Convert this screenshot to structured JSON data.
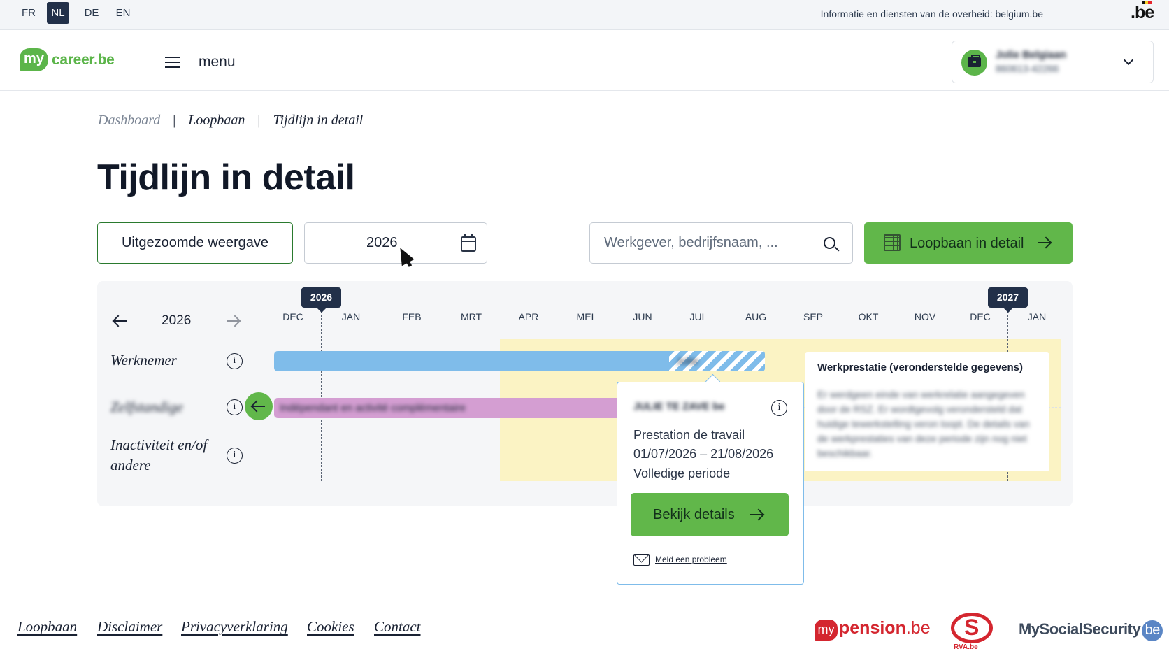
{
  "topbar": {
    "languages": [
      {
        "code": "FR",
        "active": false
      },
      {
        "code": "NL",
        "active": true
      },
      {
        "code": "DE",
        "active": false
      },
      {
        "code": "EN",
        "active": false
      }
    ],
    "gov_text": "Informatie en diensten van de overheid: belgium.be",
    "gov_logo": ".be"
  },
  "header": {
    "logo_my": "my",
    "logo_word": "career.be",
    "menu_label": "menu",
    "user_name": "Jolie Belgiaan",
    "user_id": "860613-42266"
  },
  "breadcrumb": [
    "Dashboard",
    "Loopbaan",
    "Tijdlijn in detail"
  ],
  "page_title": "Tijdlijn in detail",
  "controls": {
    "zoom_button": "Uitgezoomde weergave",
    "year_value": "2026",
    "search_placeholder": "Werkgever, bedrijfsnaam, ...",
    "career_button": "Loopbaan in detail"
  },
  "timeline": {
    "year": "2026",
    "months": [
      "DEC",
      "JAN",
      "FEB",
      "MRT",
      "APR",
      "MEI",
      "JUN",
      "JUL",
      "AUG",
      "SEP",
      "OKT",
      "NOV",
      "DEC",
      "JAN"
    ],
    "year_badges": [
      "2026",
      "2027"
    ],
    "rows": [
      {
        "label": "Werknemer"
      },
      {
        "label": "Zelfstandige"
      },
      {
        "label": "Inactiviteit en/of andere"
      }
    ],
    "hatch_label": "Jullie",
    "self_bar_label": "Indépendant en activité complémentaire",
    "info_glyph": "i"
  },
  "note": {
    "title": "Werkprestatie (veronderstelde gegevens)",
    "body": "Er werdgeen einde van werkrelatie aangegeven door de RSZ. Er wordtgevolg verondersteld dat huidige tewerkstelling veron loopt. De details van de werkprestaties van deze periode zijn nog niet beschikbaar."
  },
  "popover": {
    "employer": "JULIE TE ZAVE be",
    "line1": "Prestation de travail",
    "line2": "01/07/2026 – 21/08/2026",
    "line3": "Volledige periode",
    "details_button": "Bekijk details",
    "report_link": "Meld een probleem"
  },
  "footer": {
    "links": [
      "Loopbaan",
      "Disclaimer",
      "Privacyverklaring",
      "Cookies",
      "Contact"
    ],
    "mypension_my": "my",
    "mypension_word": "pension",
    "mypension_tld": ".be",
    "rva_s": "S",
    "rva_label": "RVA.be",
    "mss_word": "MySocialSecurity",
    "mss_tld": "be"
  },
  "colors": {
    "brand_green": "#61b74a",
    "navy": "#223049",
    "employee_bar": "#7fbcea",
    "self_bar": "#d49ed2",
    "assumed_zone": "#fbf3c4"
  }
}
